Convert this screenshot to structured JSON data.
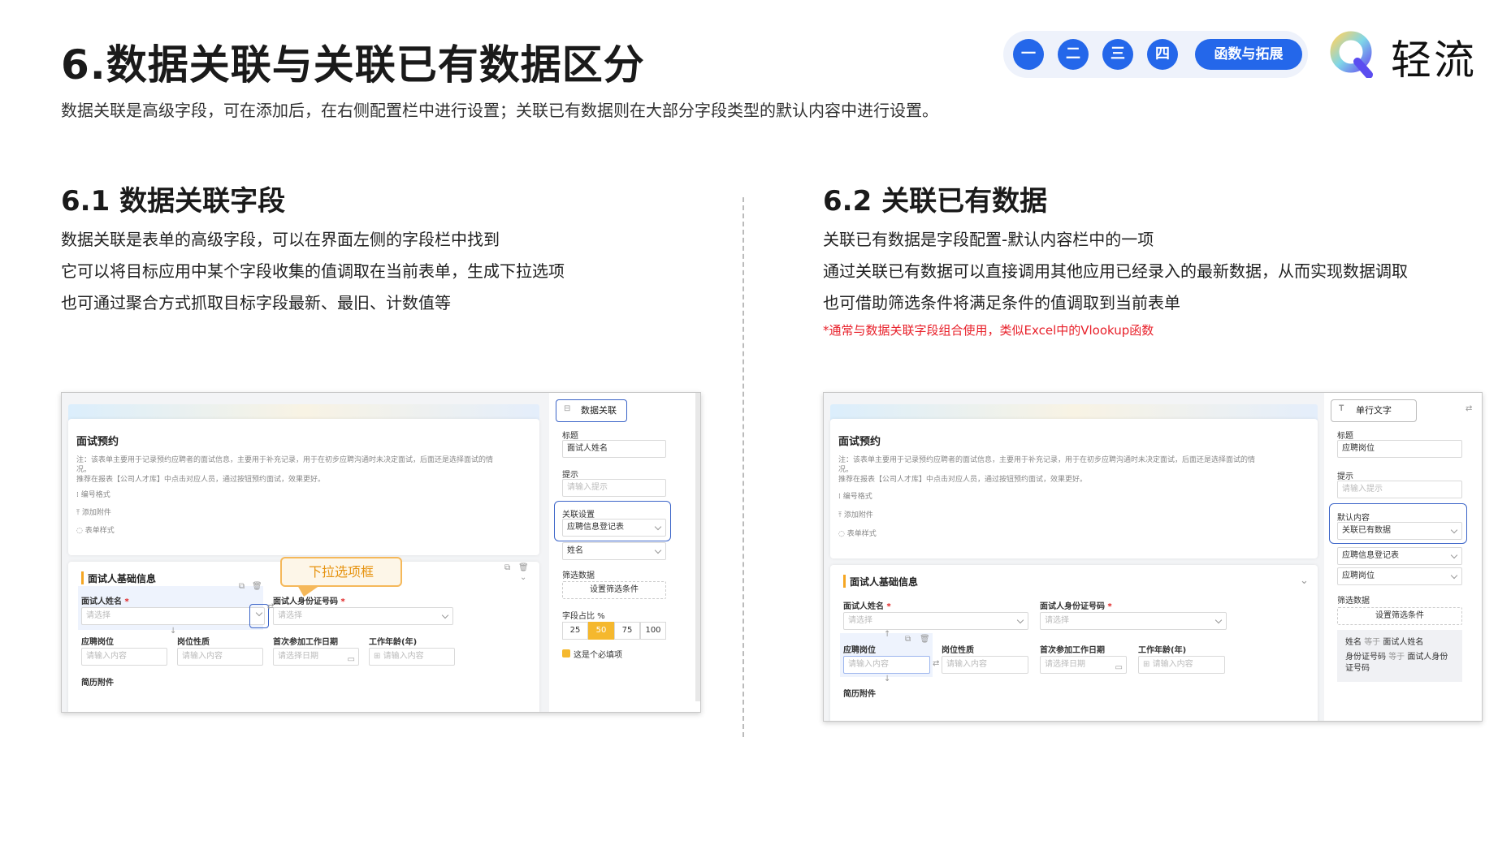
{
  "header": {
    "title": "6.数据关联与关联已有数据区分",
    "subtitle": "数据关联是高级字段，可在添加后，在右侧配置栏中进行设置；关联已有数据则在大部分字段类型的默认内容中进行设置。",
    "nav": [
      "一",
      "二",
      "三",
      "四"
    ],
    "nav_pill": "函数与拓展",
    "brand": "轻流"
  },
  "colors": {
    "accent": "#2467ea",
    "highlight": "#f5a623",
    "note": "#e8202a"
  },
  "left": {
    "heading": "6.1 数据关联字段",
    "lines": [
      "数据关联是表单的高级字段，可以在界面左侧的字段栏中找到",
      "它可以将目标应用中某个字段收集的值调取在当前表单，生成下拉选项",
      "也可通过聚合方式抓取目标字段最新、最旧、计数值等"
    ],
    "callout": "下拉选项框",
    "shot": {
      "form_title": "面试预约",
      "form_note_1": "注：该表单主要用于记录预约应聘者的面试信息，主要用于补充记录，用于在初步应聘沟通时未决定面试，后面还是选择面试的情",
      "form_note_2": "况。",
      "form_note_3": "推荐在报表【公司人才库】中点击对应人员，通过按钮预约面试，效果更好。",
      "opts": [
        "编号格式",
        "添加附件",
        "表单样式"
      ],
      "section": "面试人基础信息",
      "f1_label": "面试人姓名",
      "f1_ph": "请选择",
      "f2_label": "面试人身份证号码",
      "f2_ph": "请选择",
      "r2_labels": [
        "应聘岗位",
        "岗位性质",
        "首次参加工作日期",
        "工作年龄(年)"
      ],
      "r2_phs": [
        "请输入内容",
        "请输入内容",
        "请选择日期",
        "请输入内容"
      ],
      "r3_label": "简历附件",
      "panel": {
        "btn": "数据关联",
        "title_label": "标题",
        "title_value": "面试人姓名",
        "hint_label": "提示",
        "hint_ph": "请输入提示",
        "link_label": "关联设置",
        "link_value": "应聘信息登记表",
        "field_value": "姓名",
        "filter_label": "筛选数据",
        "filter_btn": "设置筛选条件",
        "ratio_label": "字段占比 %",
        "ratio_opts": [
          "25",
          "50",
          "75",
          "100"
        ],
        "ratio_active": "50",
        "required": "这是个必填项"
      }
    }
  },
  "right": {
    "heading": "6.2 关联已有数据",
    "lines": [
      "关联已有数据是字段配置-默认内容栏中的一项",
      "通过关联已有数据可以直接调用其他应用已经录入的最新数据，从而实现数据调取",
      "也可借助筛选条件将满足条件的值调取到当前表单"
    ],
    "note": "*通常与数据关联字段组合使用，类似Excel中的Vlookup函数",
    "shot": {
      "form_title": "面试预约",
      "form_note_1": "注：该表单主要用于记录预约应聘者的面试信息，主要用于补充记录，用于在初步应聘沟通时未决定面试，后面还是选择面试的情",
      "form_note_2": "况。",
      "form_note_3": "推荐在报表【公司人才库】中点击对应人员，通过按钮预约面试，效果更好。",
      "opts": [
        "编号格式",
        "添加附件",
        "表单样式"
      ],
      "section": "面试人基础信息",
      "f1_label": "面试人姓名",
      "f1_ph": "请选择",
      "f2_label": "面试人身份证号码",
      "f2_ph": "请选择",
      "r2_labels": [
        "应聘岗位",
        "岗位性质",
        "首次参加工作日期",
        "工作年龄(年)"
      ],
      "r2_phs": [
        "请输入内容",
        "请输入内容",
        "请选择日期",
        "请输入内容"
      ],
      "r3_label": "简历附件",
      "panel": {
        "btn": "单行文字",
        "title_label": "标题",
        "title_value": "应聘岗位",
        "hint_label": "提示",
        "hint_ph": "请输入提示",
        "default_label": "默认内容",
        "default_value": "关联已有数据",
        "source_value": "应聘信息登记表",
        "field_value": "应聘岗位",
        "filter_label": "筛选数据",
        "filter_btn": "设置筛选条件",
        "cond1_a": "姓名",
        "cond1_op": "等于",
        "cond1_b": "面试人姓名",
        "cond2_a": "身份证号码",
        "cond2_op": "等于",
        "cond2_b": "面试人身份",
        "cond2_c": "证号码"
      }
    }
  }
}
